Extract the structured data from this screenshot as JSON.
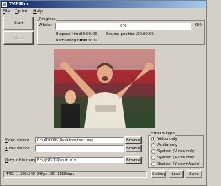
{
  "window": {
    "title": "TMPGEnc"
  },
  "menu": [
    "File",
    "Option",
    "Help"
  ],
  "buttons": {
    "start": "Start",
    "stop": "Stop"
  },
  "progress": {
    "group_title": "Progress",
    "whole_label": "Whole:",
    "percent_text": "0%",
    "percent": 0,
    "count": "0/0",
    "elapsed_label": "Elapsed time:",
    "elapsed_value": "00:00:00",
    "remaining_label": "Remaining time:",
    "remaining_value": "00:00:00",
    "source_position_label": "Source position:",
    "source_position_value": "00:00:00"
  },
  "sources": {
    "video_label": "Video source:",
    "video_value": "C:\\WINDOWS\\Desktop\\test.mpg",
    "audio_label": "Audio source:",
    "audio_value": "",
    "output_label": "Output file name:",
    "output_value": "E:\\记录\\下载\\out.m1v",
    "browse": "Browse"
  },
  "stream_type": {
    "title": "Stream type",
    "options": [
      {
        "label": "Video only",
        "checked": true
      },
      {
        "label": "Audio only",
        "checked": false
      },
      {
        "label": "System (Video only)",
        "checked": false
      },
      {
        "label": "System (Audio only)",
        "checked": false
      },
      {
        "label": "System (Video+Audio)",
        "checked": false
      }
    ]
  },
  "footer": {
    "setting": "Setting",
    "load": "Load",
    "save": "Save"
  },
  "status": "MPEG-1 320x240 24fps CBR 1150kbps"
}
